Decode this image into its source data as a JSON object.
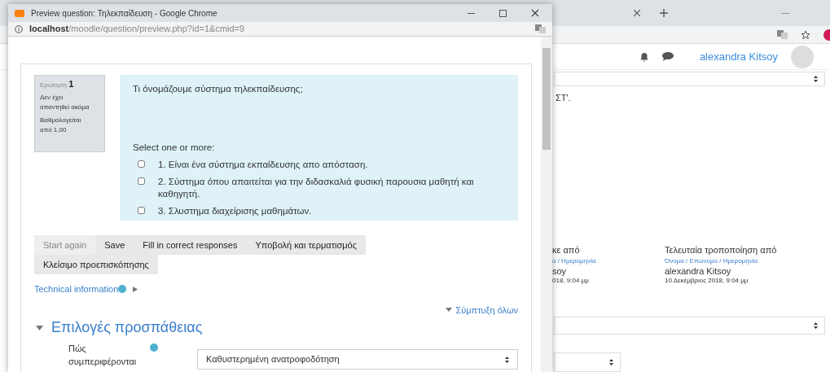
{
  "background_window": {
    "user_name": "alexandra Kitsoy",
    "text_fragment": "ΣΤ'.",
    "columns": [
      {
        "heading": "κε από",
        "subheading": "ο / Ημερομηνία",
        "name": "soy",
        "date": "018, 9:04 μμ"
      },
      {
        "heading": "Τελευταία τροποποίηση από",
        "subheading": "Όνομα / Επώνυμο / Ημερομηνία",
        "name": "alexandra Kitsoy",
        "date": "10 Δεκέμβριος 2018, 9:04 μμ"
      }
    ]
  },
  "popup": {
    "title": "Preview question: Τηλεκπαίδευση - Google Chrome",
    "url_host": "localhost",
    "url_path": "/moodle/question/preview.php?id=1&cmid=9",
    "question_info": {
      "label": "Ερώτηση",
      "number": "1",
      "status": "Δεν έχει απαντηθεί ακόμα",
      "grade": "Βαθμολογείται από 1,00"
    },
    "question_text": "Τι όνομάζουμε σύστημα τηλεκπαίδευσης;",
    "prompt": "Select one or more:",
    "options": [
      {
        "label": "1. Είναι ένα σύστημα εκπαίδευσης απο απόσταση.",
        "checked": false
      },
      {
        "label": "2. Σύστημα όπου απαιτείται για την διδασκαλιά  φυσική παρουσια μαθητή και καθηγητή.",
        "checked": false
      },
      {
        "label": "3. Σλυστημα διαχείρισης μαθημάτων.",
        "checked": false
      }
    ],
    "buttons": [
      {
        "label": "Start again",
        "disabled": true
      },
      {
        "label": "Save",
        "disabled": false
      },
      {
        "label": "Fill in correct responses",
        "disabled": false
      },
      {
        "label": "Υποβολή και τερματισμός",
        "disabled": false
      },
      {
        "label": "Κλείσιμο προεπισκόπησης",
        "disabled": false
      }
    ],
    "technical_info": "Technical information",
    "collapse_all": "Σύμπτυξη όλων",
    "section_title": "Επιλογές προσπάθειας",
    "form_field": {
      "label": "Πώς συμπεριφέρονται",
      "value": "Καθυστερημένη ανατροφοδότηση"
    }
  }
}
